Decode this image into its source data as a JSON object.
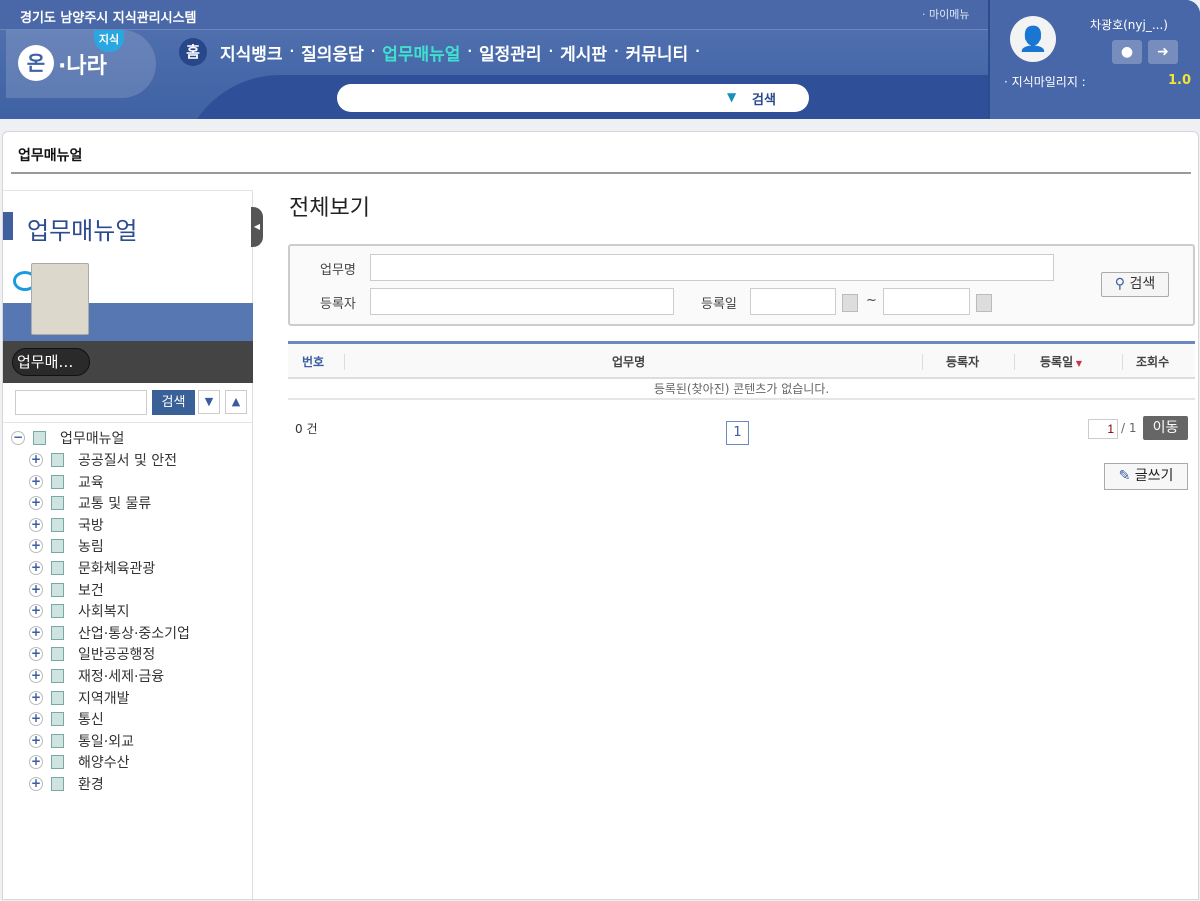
{
  "header": {
    "system_title": "경기도 남양주시 지식관리시스템",
    "my_menu": "마이메뉴",
    "logo": {
      "on": "온",
      "nara": "·나라",
      "badge": "지식"
    },
    "home": "홈",
    "nav": [
      {
        "label": "지식뱅크"
      },
      {
        "label": "질의응답"
      },
      {
        "label": "업무매뉴얼",
        "active": true
      },
      {
        "label": "일정관리"
      },
      {
        "label": "게시판"
      },
      {
        "label": "커뮤니티"
      }
    ],
    "search_button": "검색",
    "search_value": ""
  },
  "user": {
    "name": "차광호(nyj_...)",
    "mileage_label": "· 지식마일리지 :",
    "mileage": "1.0",
    "icons": [
      "user-icon",
      "logout-icon"
    ]
  },
  "breadcrumb": "업무매뉴얼",
  "sidebar": {
    "title": "업무매뉴얼",
    "pill": "업무매…",
    "search_button": "검색",
    "search_value": "",
    "tree": {
      "root": "업무매뉴얼",
      "children": [
        "공공질서 및 안전",
        "교육",
        "교통 및 물류",
        "국방",
        "농림",
        "문화체육관광",
        "보건",
        "사회복지",
        "산업·통상·중소기업",
        "일반공공행정",
        "재정·세제·금융",
        "지역개발",
        "통신",
        "통일·외교",
        "해양수산",
        "환경"
      ]
    }
  },
  "main": {
    "title": "전체보기",
    "search": {
      "name_label": "업무명",
      "author_label": "등록자",
      "date_label": "등록일",
      "tilde": "~",
      "button": "검색"
    },
    "table": {
      "headers": [
        "번호",
        "업무명",
        "등록자",
        "등록일",
        "조회수"
      ],
      "empty": "등록된(찾아진) 콘텐츠가 없습니다."
    },
    "count": "0 건",
    "current_page": "1",
    "page_input": "1",
    "page_total": "/ 1",
    "go_button": "이동",
    "write_button": "글쓰기"
  },
  "colors": {
    "header": "#4567a8",
    "active_nav": "#3fe0d0",
    "mileage": "#f2e23a",
    "table_border": "#6b88c2"
  }
}
